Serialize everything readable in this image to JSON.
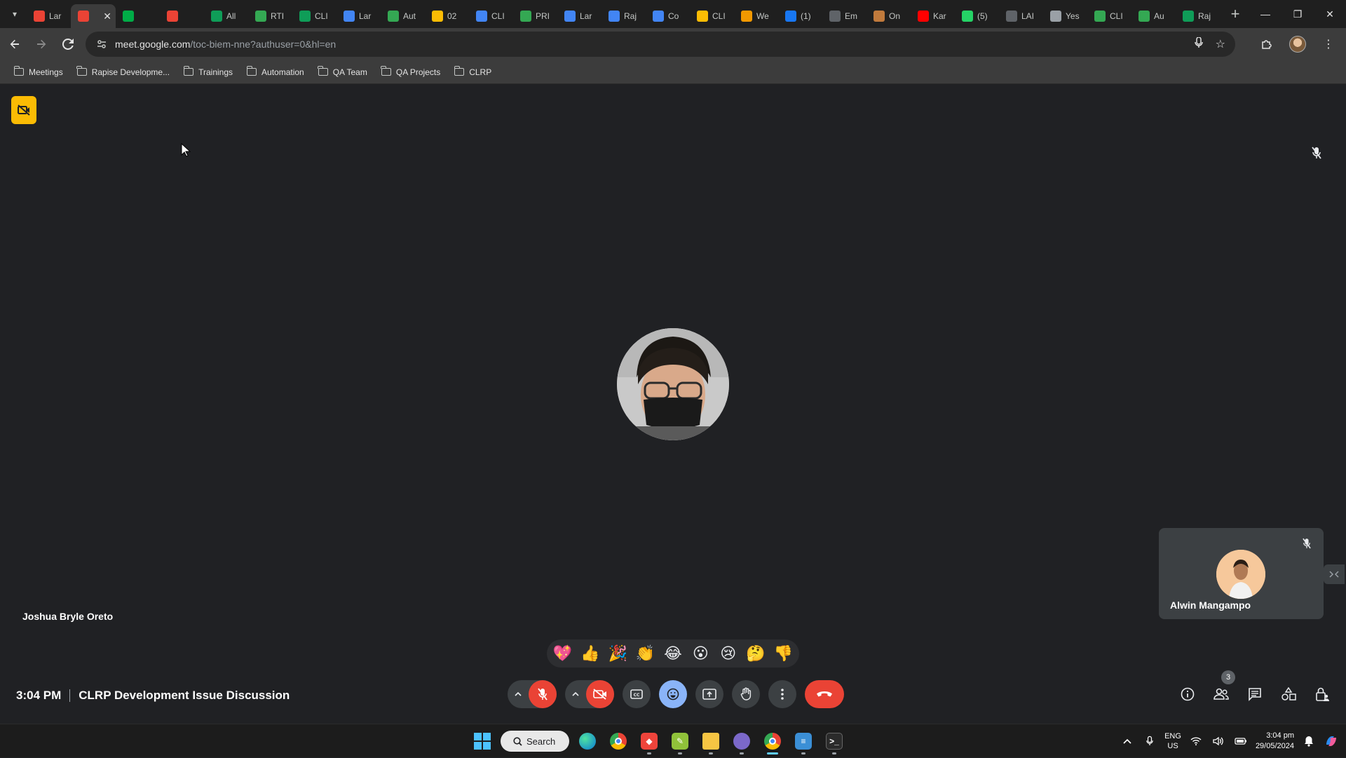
{
  "browser": {
    "tabs": [
      {
        "title": "Lar",
        "icon": "gmail-icon",
        "color": "#ea4335"
      },
      {
        "title": "",
        "icon": "recording-icon",
        "color": "#ea4335",
        "active": true
      },
      {
        "title": "",
        "icon": "meet-icon",
        "color": "#00ac47"
      },
      {
        "title": "",
        "icon": "recording-icon",
        "color": "#ea4335"
      },
      {
        "title": "All",
        "icon": "sheets-icon",
        "color": "#0f9d58"
      },
      {
        "title": "RTI",
        "icon": "app-icon",
        "color": "#34a853"
      },
      {
        "title": "CLI",
        "icon": "sheets-icon",
        "color": "#0f9d58"
      },
      {
        "title": "Lar",
        "icon": "docs-icon",
        "color": "#4285f4"
      },
      {
        "title": "Aut",
        "icon": "app-icon",
        "color": "#34a853"
      },
      {
        "title": "02",
        "icon": "drive-icon",
        "color": "#fbbc04"
      },
      {
        "title": "CLI",
        "icon": "app-icon",
        "color": "#4285f4"
      },
      {
        "title": "PRI",
        "icon": "app-icon",
        "color": "#34a853"
      },
      {
        "title": "Lar",
        "icon": "docs-icon",
        "color": "#4285f4"
      },
      {
        "title": "Raj",
        "icon": "app-icon",
        "color": "#4285f4"
      },
      {
        "title": "Co",
        "icon": "docs-icon",
        "color": "#4285f4"
      },
      {
        "title": "CLI",
        "icon": "app-icon",
        "color": "#fbbc04"
      },
      {
        "title": "We",
        "icon": "app-icon",
        "color": "#f29900"
      },
      {
        "title": "(1)",
        "icon": "facebook-icon",
        "color": "#1877f2"
      },
      {
        "title": "Em",
        "icon": "globe-icon",
        "color": "#5f6368"
      },
      {
        "title": "On",
        "icon": "box-icon",
        "color": "#c07a3c"
      },
      {
        "title": "Kar",
        "icon": "youtube-icon",
        "color": "#ff0000"
      },
      {
        "title": "(5)",
        "icon": "whatsapp-icon",
        "color": "#25d366"
      },
      {
        "title": "LAI",
        "icon": "globe-icon",
        "color": "#5f6368"
      },
      {
        "title": "Yes",
        "icon": "app-icon",
        "color": "#9aa0a6"
      },
      {
        "title": "CLI",
        "icon": "app-icon",
        "color": "#34a853"
      },
      {
        "title": "Au",
        "icon": "app-icon",
        "color": "#34a853"
      },
      {
        "title": "Raj",
        "icon": "sheets-icon",
        "color": "#0f9d58"
      }
    ],
    "url_host": "meet.google.com",
    "url_path": "/toc-biem-nne?authuser=0&hl=en",
    "bookmarks": [
      "Meetings",
      "Rapise Developme...",
      "Trainings",
      "Automation",
      "QA Team",
      "QA Projects",
      "CLRP"
    ]
  },
  "meet": {
    "main_participant": "Joshua Bryle Oreto",
    "self_tile_name": "Alwin Mangampo",
    "time": "3:04 PM",
    "meeting_title": "CLRP Development Issue Discussion",
    "participant_count": "3",
    "reactions": [
      "💖",
      "👍",
      "🎉",
      "👏",
      "😂",
      "😮",
      "😢",
      "🤔",
      "👎"
    ],
    "accent_red": "#ea4335",
    "accent_blue": "#8ab4f8"
  },
  "taskbar": {
    "search_label": "Search",
    "lang_top": "ENG",
    "lang_bottom": "US",
    "time": "3:04 pm",
    "date": "29/05/2024"
  }
}
